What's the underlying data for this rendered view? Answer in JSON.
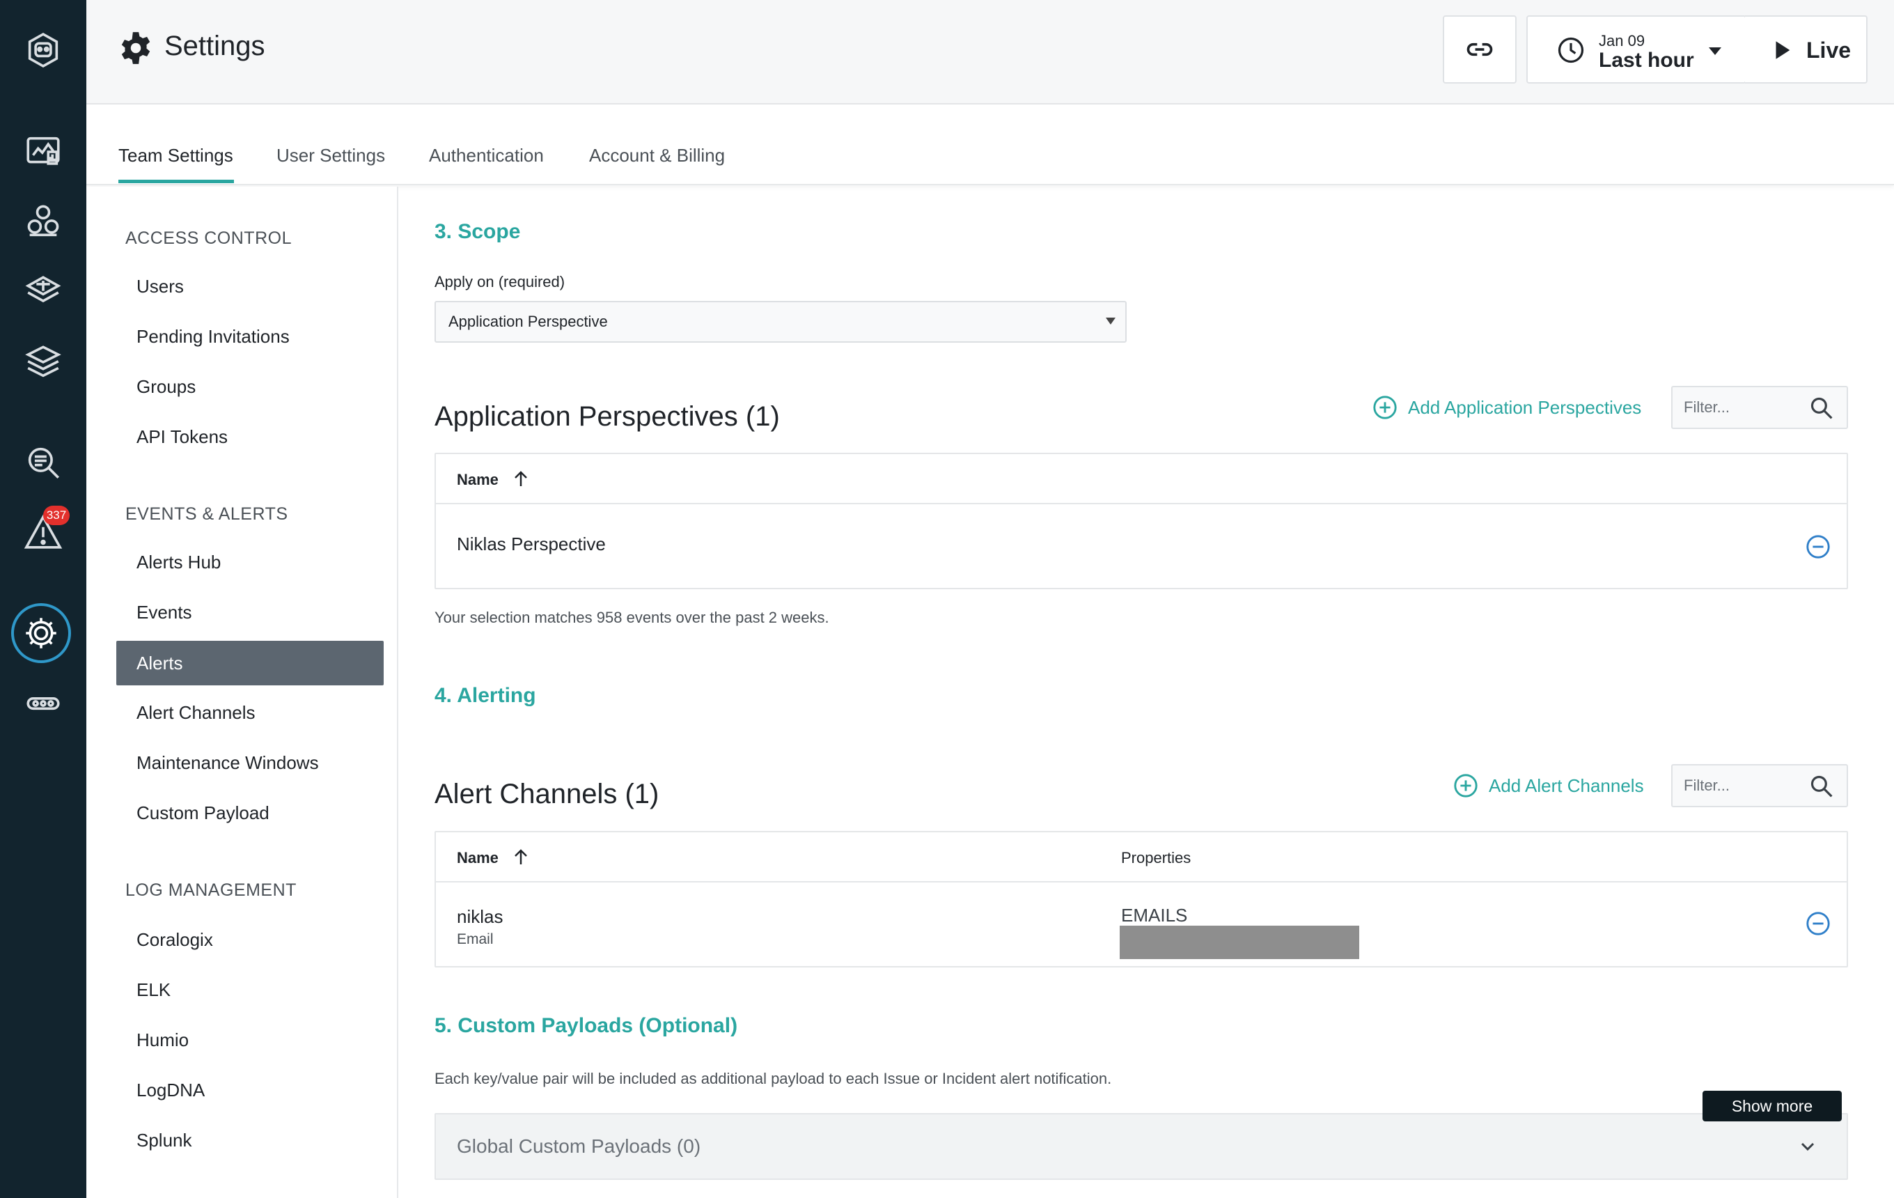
{
  "header": {
    "title": "Settings",
    "time_date": "Jan 09",
    "time_range": "Last hour",
    "live_label": "Live"
  },
  "rail": {
    "alert_count": "337"
  },
  "tabs": [
    {
      "label": "Team Settings"
    },
    {
      "label": "User Settings"
    },
    {
      "label": "Authentication"
    },
    {
      "label": "Account & Billing"
    }
  ],
  "sidebar": {
    "sections": [
      {
        "title": "ACCESS CONTROL",
        "items": [
          "Users",
          "Pending Invitations",
          "Groups",
          "API Tokens"
        ]
      },
      {
        "title": "EVENTS & ALERTS",
        "items": [
          "Alerts Hub",
          "Events",
          "Alerts",
          "Alert Channels",
          "Maintenance Windows",
          "Custom Payload"
        ]
      },
      {
        "title": "LOG MANAGEMENT",
        "items": [
          "Coralogix",
          "ELK",
          "Humio",
          "LogDNA",
          "Splunk"
        ]
      }
    ]
  },
  "scope": {
    "heading": "3. Scope",
    "field_label": "Apply on (required)",
    "selected": "Application Perspective"
  },
  "app_perspectives": {
    "heading": "Application Perspectives (1)",
    "add_label": "Add Application Perspectives",
    "filter_placeholder": "Filter...",
    "col_name": "Name",
    "rows": [
      {
        "name": "Niklas Perspective"
      }
    ],
    "match_note": "Your selection matches 958 events over the past 2 weeks."
  },
  "alerting": {
    "heading": "4. Alerting"
  },
  "alert_channels": {
    "heading": "Alert Channels (1)",
    "add_label": "Add Alert Channels",
    "filter_placeholder": "Filter...",
    "col_name": "Name",
    "col_properties": "Properties",
    "rows": [
      {
        "name": "niklas",
        "type": "Email",
        "property": "EMAILS"
      }
    ]
  },
  "custom_payloads": {
    "heading": "5. Custom Payloads (Optional)",
    "description": "Each key/value pair will be included as additional payload to each Issue or Incident alert notification.",
    "accordion_label": "Global Custom Payloads (0)",
    "tooltip": "Show more"
  },
  "colors": {
    "accent": "#2aa6a0",
    "rail": "#12242e",
    "active_nav": "#5c6670",
    "badge": "#e2302c",
    "focus_ring": "#2f98c9"
  }
}
